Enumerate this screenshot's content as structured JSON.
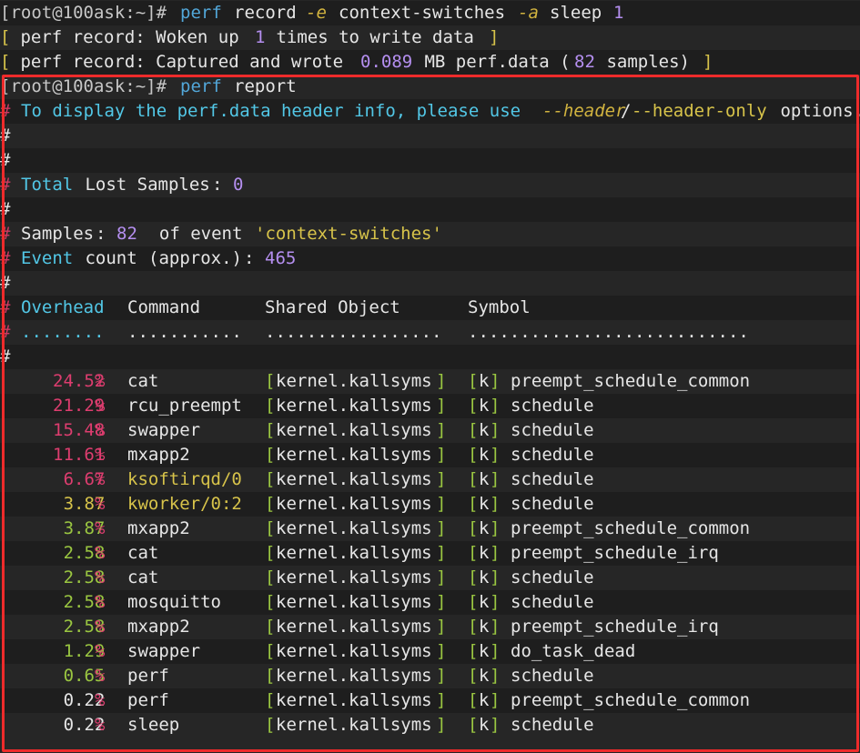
{
  "prompt": {
    "user_host": "[root@100ask:~]#"
  },
  "commands": {
    "record": {
      "perf": "perf",
      "sub": "record",
      "flag_e": "-e",
      "event": "context-switches",
      "flag_a": "-a",
      "prog": "sleep",
      "arg": "1"
    },
    "report": {
      "perf": "perf",
      "sub": "report"
    }
  },
  "record_output": {
    "line1": {
      "open": "[",
      "text1": " perf record: Woken up ",
      "num": "1",
      "text2": " times to write data ",
      "close": "]"
    },
    "line2": {
      "open": "[",
      "text1": " perf record: Captured and wrote ",
      "num": "0.089",
      "text2": " MB perf.data (",
      "num2": "82",
      "text3": " samples) ",
      "close": "]"
    }
  },
  "report_header": {
    "hash": "#",
    "info_pre": "To display the perf.data header info, please use ",
    "opt1": "--header",
    "slash": "/",
    "opt2": "--header-only",
    "info_post": " options.",
    "total_label1": "Total",
    "total_label2": " Lost Samples",
    "total_colon": ": ",
    "total_value": "0",
    "samples_label": "Samples",
    "samples_colon": ": ",
    "samples_value": "82",
    "samples_mid": "  of event ",
    "samples_event": "'context-switches'",
    "event_label1": "Event",
    "event_label2": " count ",
    "event_label3": "(approx.)",
    "event_colon": ": ",
    "event_value": "465",
    "col_overhead": "Overhead",
    "col_command": "Command",
    "col_shared": "Shared Object",
    "col_symbol": "Symbol",
    "dots_overhead": "........",
    "dots_command": "...........",
    "dots_shared": ".................",
    "dots_symbol": "..........................."
  },
  "rows": [
    {
      "pct": "24.52",
      "pct_color": "red",
      "cmd": "cat",
      "cmd_color": "white",
      "dso": "kernel.kallsyms",
      "ring": "k",
      "sym": "preempt_schedule_common"
    },
    {
      "pct": "21.29",
      "pct_color": "red",
      "cmd": "rcu_preempt",
      "cmd_color": "white",
      "dso": "kernel.kallsyms",
      "ring": "k",
      "sym": "schedule"
    },
    {
      "pct": "15.48",
      "pct_color": "red",
      "cmd": "swapper",
      "cmd_color": "white",
      "dso": "kernel.kallsyms",
      "ring": "k",
      "sym": "schedule"
    },
    {
      "pct": "11.61",
      "pct_color": "red",
      "cmd": "mxapp2",
      "cmd_color": "white",
      "dso": "kernel.kallsyms",
      "ring": "k",
      "sym": "schedule"
    },
    {
      "pct": "6.67",
      "pct_color": "red",
      "cmd": "ksoftirqd/0",
      "cmd_color": "yellow",
      "dso": "kernel.kallsyms",
      "ring": "k",
      "sym": "schedule"
    },
    {
      "pct": "3.87",
      "pct_color": "yellow",
      "cmd": "kworker/0:2",
      "cmd_color": "yellow",
      "dso": "kernel.kallsyms",
      "ring": "k",
      "sym": "schedule"
    },
    {
      "pct": "3.87",
      "pct_color": "green",
      "cmd": "mxapp2",
      "cmd_color": "white",
      "dso": "kernel.kallsyms",
      "ring": "k",
      "sym": "preempt_schedule_common"
    },
    {
      "pct": "2.58",
      "pct_color": "green",
      "cmd": "cat",
      "cmd_color": "white",
      "dso": "kernel.kallsyms",
      "ring": "k",
      "sym": "preempt_schedule_irq"
    },
    {
      "pct": "2.58",
      "pct_color": "green",
      "cmd": "cat",
      "cmd_color": "white",
      "dso": "kernel.kallsyms",
      "ring": "k",
      "sym": "schedule"
    },
    {
      "pct": "2.58",
      "pct_color": "green",
      "cmd": "mosquitto",
      "cmd_color": "white",
      "dso": "kernel.kallsyms",
      "ring": "k",
      "sym": "schedule"
    },
    {
      "pct": "2.58",
      "pct_color": "green",
      "cmd": "mxapp2",
      "cmd_color": "white",
      "dso": "kernel.kallsyms",
      "ring": "k",
      "sym": "preempt_schedule_irq"
    },
    {
      "pct": "1.29",
      "pct_color": "green",
      "cmd": "swapper",
      "cmd_color": "white",
      "dso": "kernel.kallsyms",
      "ring": "k",
      "sym": "do_task_dead"
    },
    {
      "pct": "0.65",
      "pct_color": "green",
      "cmd": "perf",
      "cmd_color": "white",
      "dso": "kernel.kallsyms",
      "ring": "k",
      "sym": "schedule"
    },
    {
      "pct": "0.22",
      "pct_color": "white",
      "cmd": "perf",
      "cmd_color": "white",
      "dso": "kernel.kallsyms",
      "ring": "k",
      "sym": "preempt_schedule_common"
    },
    {
      "pct": "0.22",
      "pct_color": "white",
      "cmd": "sleep",
      "cmd_color": "white",
      "dso": "kernel.kallsyms",
      "ring": "k",
      "sym": "schedule"
    }
  ],
  "colors": {
    "highlight_box": "#ee2b2b",
    "background": "#262626",
    "row_alt": "#1e1e1e",
    "pct_red": "#dd3d6f",
    "pct_yellow": "#d7c34a",
    "pct_green": "#9ac641",
    "pct_white": "#e6e6e6"
  }
}
